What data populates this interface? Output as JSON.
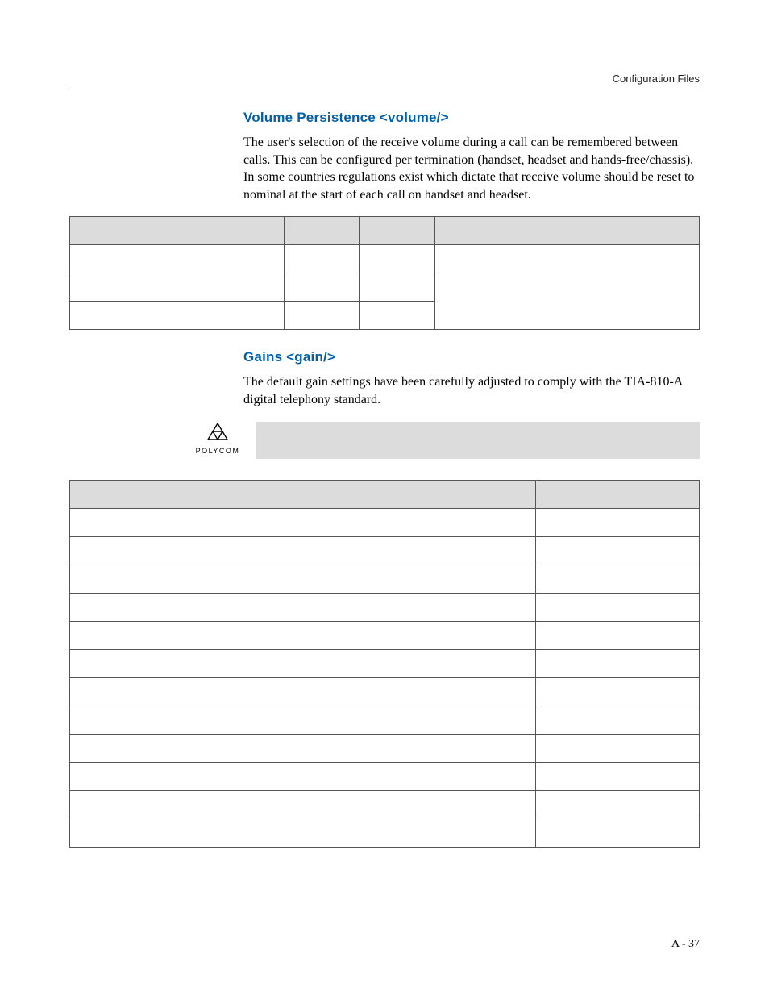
{
  "running_head": "Configuration Files",
  "section1": {
    "title": "Volume Persistence <volume/>",
    "body": "The user's selection of the receive volume during a call can be remembered between calls. This can be configured per termination (handset, headset and hands-free/chassis). In some countries regulations exist which dictate that receive volume should be reset to nominal at the start of each call on handset and headset."
  },
  "table1": {
    "header_cols": 4,
    "row_count": 3,
    "last_col_rowspan": 3
  },
  "section2": {
    "title": "Gains <gain/>",
    "body": "The default gain settings have been carefully adjusted to comply with the TIA-810-A digital telephony standard."
  },
  "note": {
    "brand": "POLYCOM"
  },
  "table2": {
    "header_cols": 2,
    "row_count": 12
  },
  "page_number": "A - 37"
}
